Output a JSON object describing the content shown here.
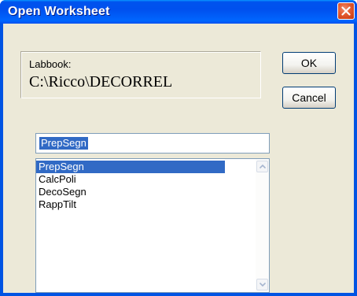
{
  "window": {
    "title": "Open Worksheet",
    "close_icon": "close-x-icon"
  },
  "labbook": {
    "label": "Labbook:",
    "path": "C:\\Ricco\\DECORREL"
  },
  "buttons": {
    "ok_label": "OK",
    "cancel_label": "Cancel"
  },
  "name_field": {
    "value": "PrepSegn"
  },
  "worksheet_list": {
    "items": [
      "PrepSegn",
      "CalcPoli",
      "DecoSegn",
      "RappTilt"
    ],
    "selected_index": 0
  },
  "colors": {
    "titlebar": "#0054e3",
    "selection": "#316ac5",
    "dialog_background": "#ece9d8",
    "close_button": "#e35a30"
  }
}
